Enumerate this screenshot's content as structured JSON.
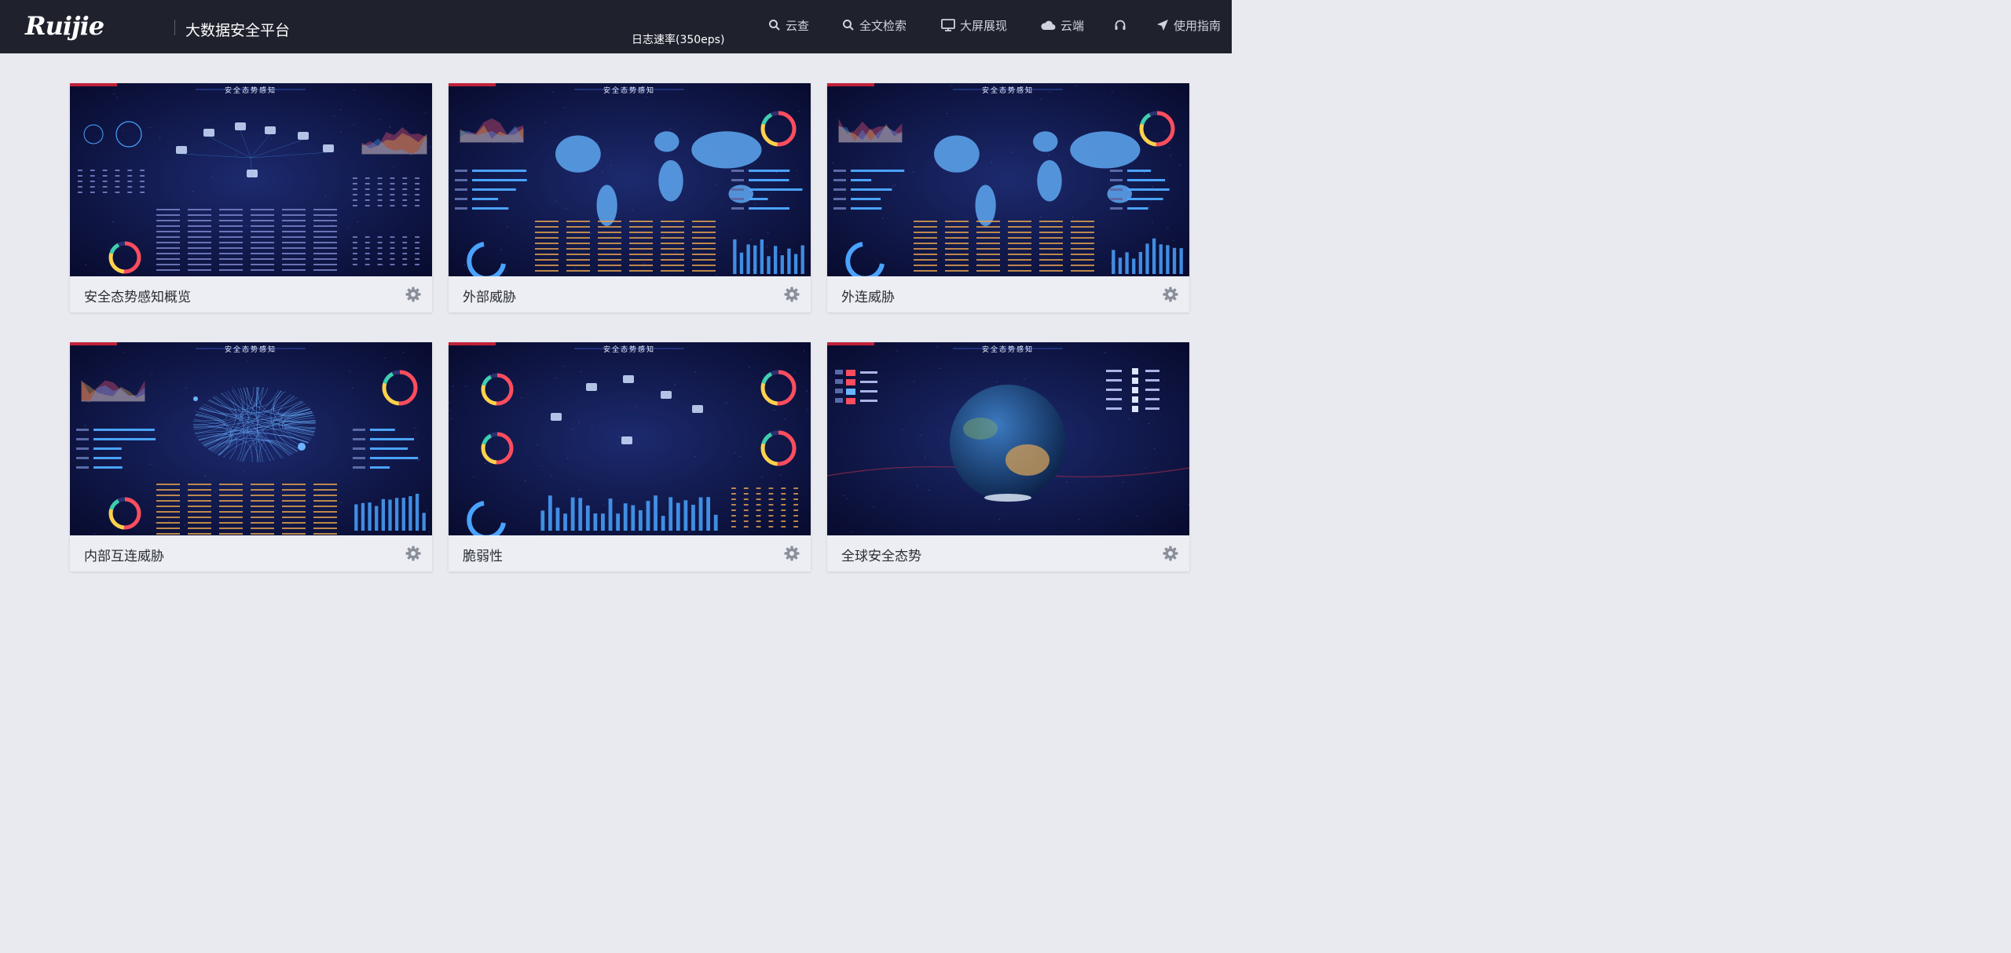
{
  "header": {
    "logo_text": "Ruijie",
    "app_title": "大数据安全平台",
    "log_rate": "日志速率(350eps)",
    "nav": [
      {
        "label": "云查",
        "icon": "search-icon"
      },
      {
        "label": "全文检索",
        "icon": "search-icon"
      },
      {
        "label": "大屏展现",
        "icon": "monitor-icon"
      },
      {
        "label": "云端",
        "icon": "cloud-icon"
      },
      {
        "label": "",
        "icon": "headset-icon"
      },
      {
        "label": "使用指南",
        "icon": "send-icon"
      }
    ]
  },
  "thumb_heading": "安全态势感知",
  "cards": [
    {
      "label": "安全态势感知概览",
      "thumb": "overview"
    },
    {
      "label": "外部威胁",
      "thumb": "map"
    },
    {
      "label": "外连威胁",
      "thumb": "map"
    },
    {
      "label": "内部互连威胁",
      "thumb": "network"
    },
    {
      "label": "脆弱性",
      "thumb": "vuln"
    },
    {
      "label": "全球安全态势",
      "thumb": "globe"
    }
  ],
  "colors": {
    "topbar": "#1f222d",
    "page_bg": "#e9eaef",
    "thumb_bg": "#0b0e36",
    "accent_blue": "#4aa3ff",
    "accent_red": "#ff4d5e",
    "accent_yellow": "#ffd24a"
  }
}
